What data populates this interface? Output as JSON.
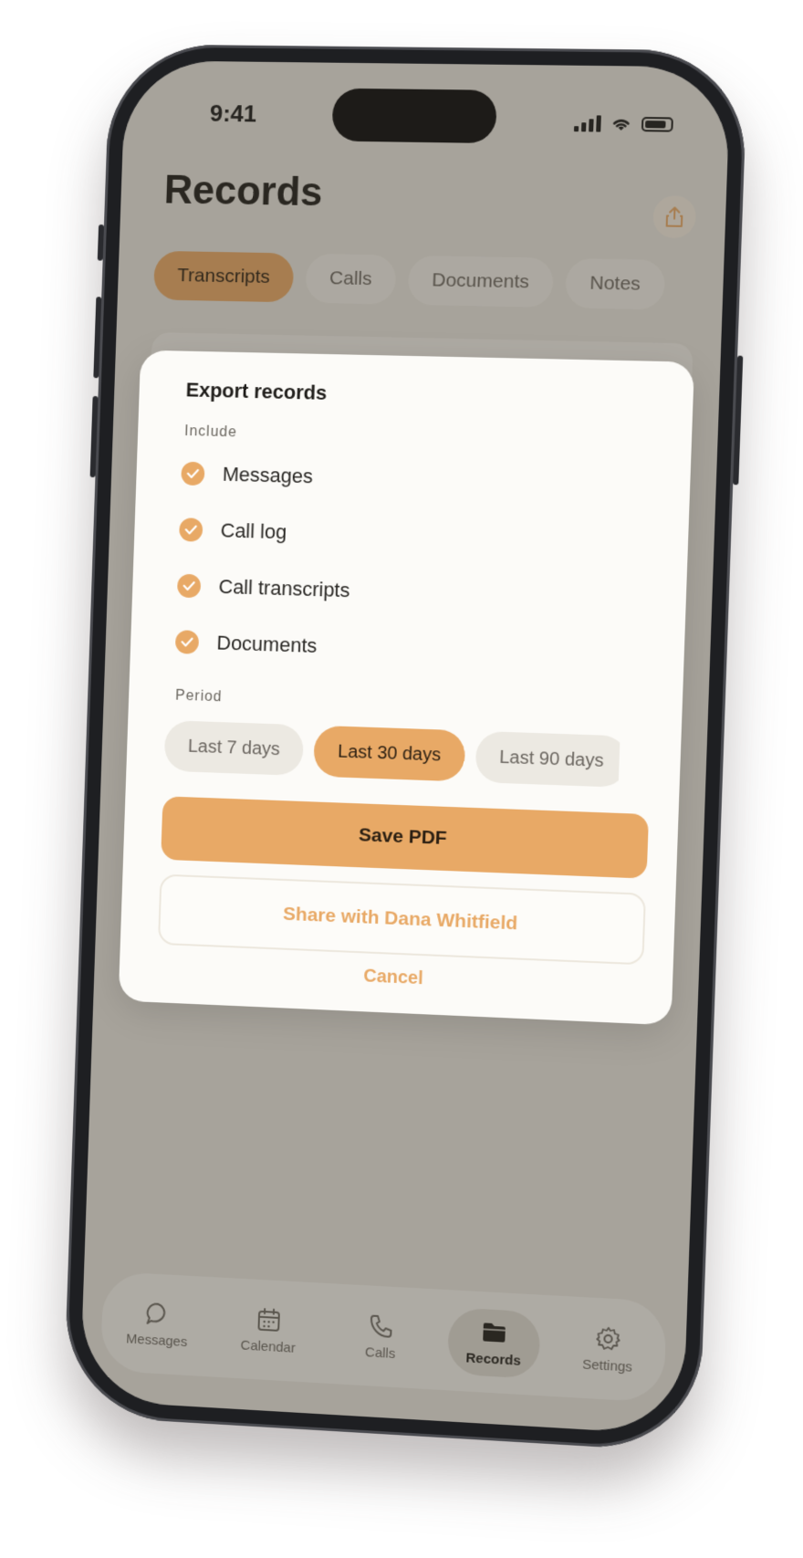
{
  "status_bar": {
    "time": "9:41"
  },
  "header": {
    "title": "Records",
    "share_icon": "share-icon"
  },
  "tabs": [
    {
      "label": "Transcripts",
      "active": true
    },
    {
      "label": "Calls",
      "active": false
    },
    {
      "label": "Documents",
      "active": false
    },
    {
      "label": "Notes",
      "active": false
    }
  ],
  "modal": {
    "title": "Export records",
    "include_label": "Include",
    "options": [
      {
        "label": "Messages",
        "checked": true
      },
      {
        "label": "Call log",
        "checked": true
      },
      {
        "label": "Call transcripts",
        "checked": true
      },
      {
        "label": "Documents",
        "checked": true
      }
    ],
    "period_label": "Period",
    "periods": [
      {
        "label": "Last 7 days",
        "active": false
      },
      {
        "label": "Last 30 days",
        "active": true
      },
      {
        "label": "Last 90 days",
        "active": false
      }
    ],
    "primary_button": "Save PDF",
    "secondary_button": "Share with Dana Whitfield",
    "cancel": "Cancel"
  },
  "tab_bar": [
    {
      "label": "Messages",
      "icon": "chat-bubble-icon",
      "active": false
    },
    {
      "label": "Calendar",
      "icon": "calendar-icon",
      "active": false
    },
    {
      "label": "Calls",
      "icon": "phone-icon",
      "active": false
    },
    {
      "label": "Records",
      "icon": "folder-icon",
      "active": true
    },
    {
      "label": "Settings",
      "icon": "gear-icon",
      "active": false
    }
  ],
  "colors": {
    "accent": "#e8a966",
    "background": "#e9e6df",
    "modal": "#fcfbf8"
  }
}
